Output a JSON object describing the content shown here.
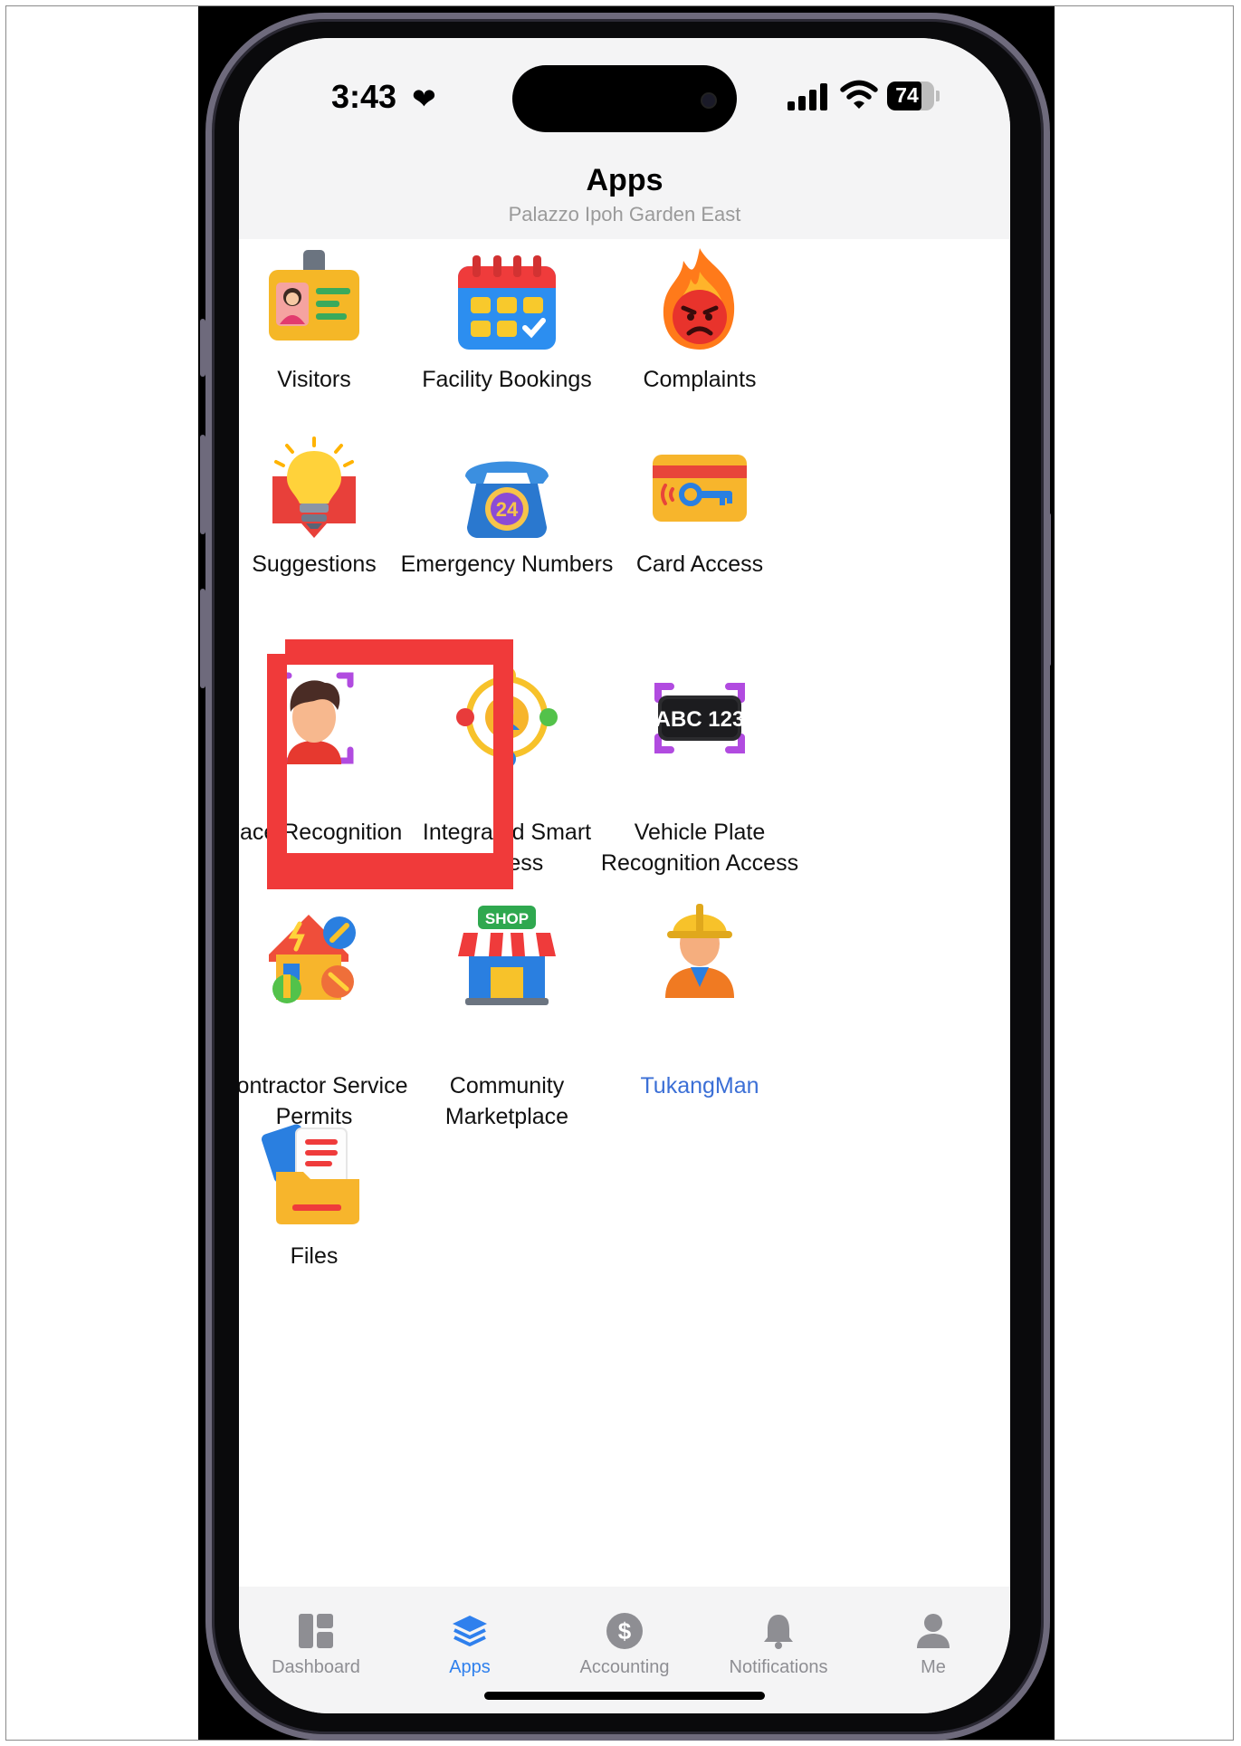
{
  "status_bar": {
    "time": "3:43",
    "battery": "74",
    "battery_level": 0.74
  },
  "header": {
    "title": "Apps",
    "subtitle": "Palazzo Ipoh Garden East"
  },
  "apps": [
    {
      "label": "Visitors",
      "icon": "id-badge-icon"
    },
    {
      "label": "Facility Bookings",
      "icon": "calendar-icon"
    },
    {
      "label": "Complaints",
      "icon": "angry-fire-icon"
    },
    {
      "label": "Suggestions",
      "icon": "lightbulb-icon"
    },
    {
      "label": "Emergency Numbers",
      "icon": "phone-24-icon"
    },
    {
      "label": "Card Access",
      "icon": "key-card-icon"
    },
    {
      "label": "Face Recognition\nAccess",
      "icon": "face-scan-icon"
    },
    {
      "label": "Integrated Smart\nAccess",
      "icon": "network-user-icon"
    },
    {
      "label": "Vehicle Plate\nRecognition Access",
      "icon": "license-plate-icon",
      "plate_text": "ABC 123"
    },
    {
      "label": "Contractor Service\nPermits",
      "icon": "home-tools-icon"
    },
    {
      "label": "Community\nMarketplace",
      "icon": "shop-icon",
      "sign_text": "SHOP"
    },
    {
      "label": "TukangMan",
      "icon": "worker-icon"
    },
    {
      "label": "Files",
      "icon": "folder-icon"
    }
  ],
  "highlight": {
    "target": "Face Recognition Access",
    "color": "#f03a3a"
  },
  "tabs": [
    {
      "label": "Dashboard",
      "icon": "dashboard-icon",
      "active": false
    },
    {
      "label": "Apps",
      "icon": "layers-icon",
      "active": true
    },
    {
      "label": "Accounting",
      "icon": "dollar-icon",
      "active": false
    },
    {
      "label": "Notifications",
      "icon": "bell-icon",
      "active": false
    },
    {
      "label": "Me",
      "icon": "person-icon",
      "active": false
    }
  ],
  "colors": {
    "accent": "#2f80ed",
    "link": "#3b6fd6",
    "highlight": "#f03a3a"
  }
}
